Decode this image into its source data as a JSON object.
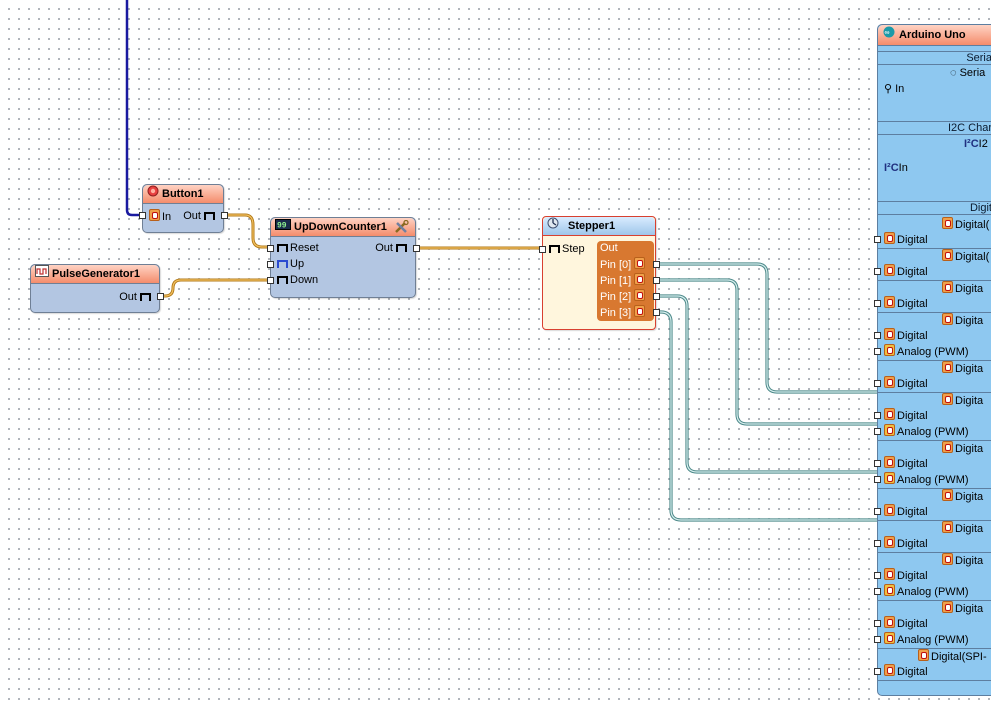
{
  "components": {
    "button": {
      "title": "Button1",
      "in": "In",
      "out": "Out"
    },
    "pulse_generator": {
      "title": "PulseGenerator1",
      "out": "Out"
    },
    "counter": {
      "title": "UpDownCounter1",
      "reset": "Reset",
      "up": "Up",
      "down": "Down",
      "out": "Out"
    },
    "stepper": {
      "title": "Stepper1",
      "step": "Step",
      "out_group": "Out",
      "pins": [
        "Pin [0]",
        "Pin [1]",
        "Pin [2]",
        "Pin [3]"
      ]
    }
  },
  "arduino": {
    "title": "Arduino Uno",
    "serial": {
      "header": "Seria",
      "sub": "Seria",
      "in": "In"
    },
    "i2c": {
      "header": "I2C Char",
      "sub": "I2",
      "in": "In"
    },
    "digital_header": "Digit",
    "channels": [
      {
        "sub": "Digital(",
        "pins": [
          "Digital"
        ]
      },
      {
        "sub": "Digital(",
        "pins": [
          "Digital"
        ]
      },
      {
        "sub": "Digita",
        "pins": [
          "Digital"
        ]
      },
      {
        "sub": "Digita",
        "pins": [
          "Digital",
          "Analog (PWM)"
        ]
      },
      {
        "sub": "Digita",
        "pins": [
          "Digital"
        ]
      },
      {
        "sub": "Digita",
        "pins": [
          "Digital",
          "Analog (PWM)"
        ]
      },
      {
        "sub": "Digita",
        "pins": [
          "Digital",
          "Analog (PWM)"
        ]
      },
      {
        "sub": "Digita",
        "pins": [
          "Digital"
        ]
      },
      {
        "sub": "Digita",
        "pins": [
          "Digital"
        ]
      },
      {
        "sub": "Digita",
        "pins": [
          "Digital",
          "Analog (PWM)"
        ]
      },
      {
        "sub": "Digita",
        "pins": [
          "Digital",
          "Analog (PWM)"
        ]
      },
      {
        "sub": "Digital(SPI-",
        "pins": [
          "Digital"
        ]
      }
    ]
  },
  "colors": {
    "wire_pulse": "#e0a020",
    "wire_digital": "#6aa6a6",
    "wire_top": "#1a1aa0",
    "board": "#8ec8f0",
    "title_gradient_end": "#f48c6c"
  },
  "icons": [
    "button-icon",
    "pulse-generator-icon",
    "counter-icon",
    "tools-icon",
    "stepper-icon",
    "arduino-icon"
  ]
}
